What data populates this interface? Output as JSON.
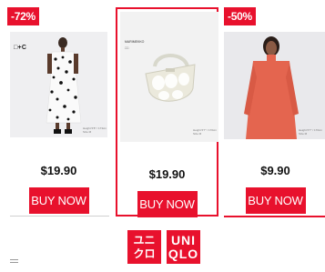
{
  "products": [
    {
      "discount": "-72%",
      "brand_tag": "□+C",
      "image_caption": "Height 5'8\" / 173cm Size M",
      "price": "$19.90",
      "buy_label": "BUY NOW"
    },
    {
      "brand_small": "MARIMEKKO",
      "brand_small_2": "□□",
      "image_caption": "Height 5'7\" / 170cm Size M",
      "price": "$19.90",
      "buy_label": "BUY NOW"
    },
    {
      "discount": "-50%",
      "image_caption": "Height 5'7\" / 170cm Size M",
      "price": "$9.90",
      "buy_label": "BUY NOW"
    }
  ],
  "logo": {
    "katakana_line1": "ユニ",
    "katakana_line2": "クロ",
    "latin_line1": "UNI",
    "latin_line2": "QLO"
  },
  "colors": {
    "brand_red": "#e8112d"
  }
}
